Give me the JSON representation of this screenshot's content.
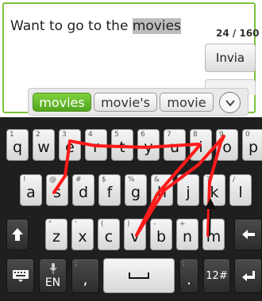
{
  "compose": {
    "text_before": "Want to go to the ",
    "text_selected": "movies",
    "char_counter": "24 / 160",
    "send_label": "Invia"
  },
  "suggestions": {
    "items": [
      "movies",
      "movie's",
      "movie"
    ],
    "active_index": 0,
    "expand_icon": "chevron-down-icon"
  },
  "keyboard": {
    "rows": [
      [
        {
          "k": "q",
          "h": "1"
        },
        {
          "k": "w",
          "h": "2"
        },
        {
          "k": "e",
          "h": "3"
        },
        {
          "k": "r",
          "h": "4"
        },
        {
          "k": "t",
          "h": "5"
        },
        {
          "k": "y",
          "h": "6"
        },
        {
          "k": "u",
          "h": "7"
        },
        {
          "k": "i",
          "h": "8"
        },
        {
          "k": "o",
          "h": "9"
        },
        {
          "k": "p",
          "h": "0"
        }
      ],
      [
        {
          "k": "a",
          "h": "!"
        },
        {
          "k": "s",
          "h": "@"
        },
        {
          "k": "d",
          "h": "#"
        },
        {
          "k": "f",
          "h": "$"
        },
        {
          "k": "g",
          "h": "%"
        },
        {
          "k": "h",
          "h": "&"
        },
        {
          "k": "j",
          "h": "*"
        },
        {
          "k": "k",
          "h": "?"
        },
        {
          "k": "l",
          "h": "/"
        }
      ],
      [
        {
          "k": "z",
          "h": "\""
        },
        {
          "k": "x",
          "h": "'"
        },
        {
          "k": "c",
          "h": "("
        },
        {
          "k": "v",
          "h": ")"
        },
        {
          "k": "b",
          "h": "-"
        },
        {
          "k": "n",
          "h": "+"
        },
        {
          "k": "m",
          "h": ""
        }
      ]
    ],
    "shift_icon": "shift-arrow-icon",
    "delete_icon": "backspace-arrow-icon",
    "keyboard_icon": "keyboard-icon",
    "mic_icon": "microphone-icon",
    "lang_label": "EN",
    "comma_label": ",",
    "comma_hint": ";",
    "space_icon": "space-bar-icon",
    "period_label": ".",
    "period_hint": ":",
    "symbols_label": "12#",
    "enter_icon": "enter-arrow-icon"
  },
  "colors": {
    "accent_green": "#7cc437",
    "trace_red": "#ff1a1a",
    "keyboard_bg": "#1f1f1f"
  }
}
